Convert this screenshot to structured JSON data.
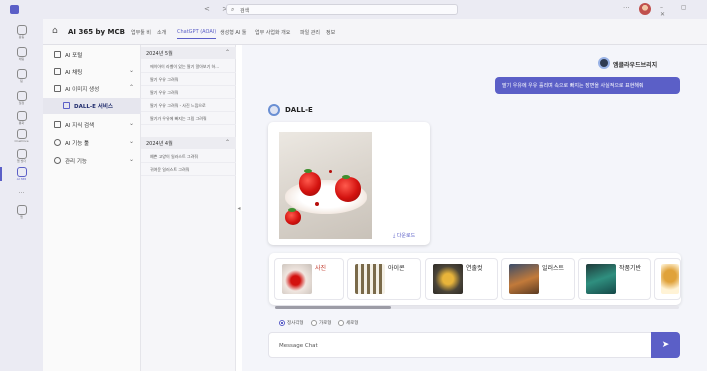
{
  "titlebar": {
    "nav_arrows": "< >",
    "search_text": "검색",
    "more": "···",
    "window_controls": "– ▢ ✕"
  },
  "rail": {
    "items": [
      {
        "label": "활동",
        "icon": "bell-icon"
      },
      {
        "label": "채팅",
        "icon": "chat-icon"
      },
      {
        "label": "팀",
        "icon": "teams-icon"
      },
      {
        "label": "일정",
        "icon": "calendar-icon"
      },
      {
        "label": "통화",
        "icon": "phone-icon"
      },
      {
        "label": "OneDrive",
        "icon": "cloud-icon"
      },
      {
        "label": "앱 빌더",
        "icon": "apps-icon"
      },
      {
        "label": "AI 365",
        "icon": "ai365-icon"
      },
      {
        "label": "",
        "icon": "more-icon"
      },
      {
        "label": "앱",
        "icon": "store-icon"
      }
    ]
  },
  "header": {
    "title": "AI 365 by MCB",
    "tabs": [
      "업무툴 비",
      "소개",
      "ChatGPT (AOAI)",
      "생성형 AI 툴",
      "업무 사업화 개요",
      "파일 관리",
      "정보"
    ]
  },
  "menu": {
    "items": [
      {
        "label": "AI 포털",
        "chevron": ""
      },
      {
        "label": "AI 채팅",
        "chevron": "⌄"
      },
      {
        "label": "AI 이미지 생성",
        "chevron": "⌃"
      },
      {
        "label": "DALL-E 서비스",
        "chevron": ""
      },
      {
        "label": "AI 지식 검색",
        "chevron": "⌄"
      },
      {
        "label": "AI 기능 툴",
        "chevron": "⌄"
      },
      {
        "label": "관리 기능",
        "chevron": "⌄"
      }
    ]
  },
  "history": {
    "groups": [
      {
        "label": "2024년 5월",
        "chevron": "⌃",
        "items": [
          "에이아이 라벨이 있는 딸기 알아보기 하...",
          "딸기 우유 그려줘",
          "딸기 우유 그려줘",
          "딸기 우유 그려줘 - 사진 느낌으로",
          "딸기가 우유에 빠지는 그림 그려줘"
        ]
      },
      {
        "label": "2024년 4월",
        "chevron": "⌃",
        "items": [
          "예쁜 고양이 일러스트 그려줘",
          "귀여운 일러스트 그려줘"
        ]
      }
    ]
  },
  "chat": {
    "bot_name": "엠클라우드브리지",
    "user_message": "딸기 우유에 우유 흘리며 속으로 빠지는 장면을 사실적으로 표현해줘",
    "assistant_name": "DALL-E",
    "download_label": "다운로드",
    "categories": [
      {
        "label": "사진",
        "active": true
      },
      {
        "label": "아이콘",
        "active": false
      },
      {
        "label": "연출컷",
        "active": false
      },
      {
        "label": "일러스트",
        "active": false
      },
      {
        "label": "작품기반",
        "active": false
      },
      {
        "label": "",
        "active": false
      }
    ],
    "scroll_position": 0.28,
    "radios": [
      {
        "label": "정사각형",
        "checked": true
      },
      {
        "label": "가로형",
        "checked": false
      },
      {
        "label": "세로형",
        "checked": false
      }
    ],
    "input_placeholder": "Message Chat",
    "send_icon": "send-icon"
  },
  "colors": {
    "accent": "#5b5fc7",
    "active_category": "#c0392b"
  }
}
